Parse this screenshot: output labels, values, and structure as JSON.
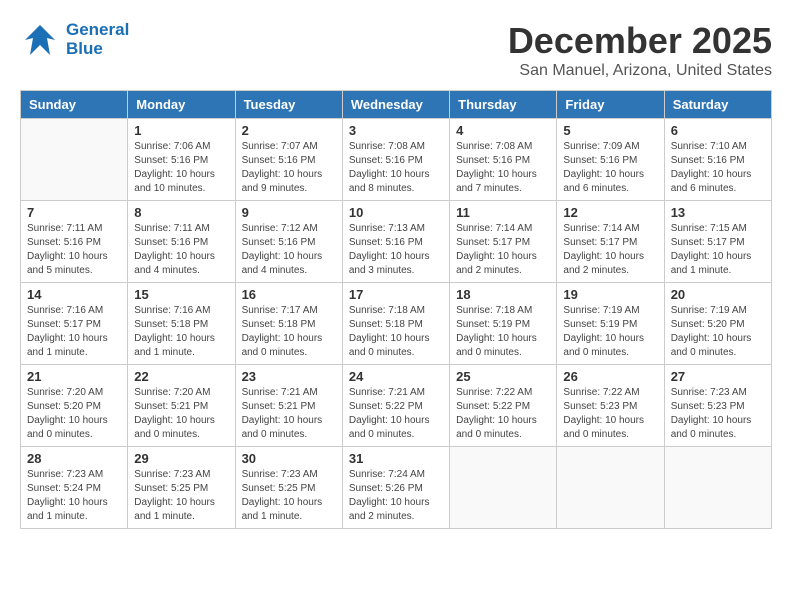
{
  "header": {
    "logo_general": "General",
    "logo_blue": "Blue",
    "month_title": "December 2025",
    "location": "San Manuel, Arizona, United States"
  },
  "weekdays": [
    "Sunday",
    "Monday",
    "Tuesday",
    "Wednesday",
    "Thursday",
    "Friday",
    "Saturday"
  ],
  "weeks": [
    [
      {
        "day": "",
        "sunrise": "",
        "sunset": "",
        "daylight": ""
      },
      {
        "day": "1",
        "sunrise": "Sunrise: 7:06 AM",
        "sunset": "Sunset: 5:16 PM",
        "daylight": "Daylight: 10 hours and 10 minutes."
      },
      {
        "day": "2",
        "sunrise": "Sunrise: 7:07 AM",
        "sunset": "Sunset: 5:16 PM",
        "daylight": "Daylight: 10 hours and 9 minutes."
      },
      {
        "day": "3",
        "sunrise": "Sunrise: 7:08 AM",
        "sunset": "Sunset: 5:16 PM",
        "daylight": "Daylight: 10 hours and 8 minutes."
      },
      {
        "day": "4",
        "sunrise": "Sunrise: 7:08 AM",
        "sunset": "Sunset: 5:16 PM",
        "daylight": "Daylight: 10 hours and 7 minutes."
      },
      {
        "day": "5",
        "sunrise": "Sunrise: 7:09 AM",
        "sunset": "Sunset: 5:16 PM",
        "daylight": "Daylight: 10 hours and 6 minutes."
      },
      {
        "day": "6",
        "sunrise": "Sunrise: 7:10 AM",
        "sunset": "Sunset: 5:16 PM",
        "daylight": "Daylight: 10 hours and 6 minutes."
      }
    ],
    [
      {
        "day": "7",
        "sunrise": "Sunrise: 7:11 AM",
        "sunset": "Sunset: 5:16 PM",
        "daylight": "Daylight: 10 hours and 5 minutes."
      },
      {
        "day": "8",
        "sunrise": "Sunrise: 7:11 AM",
        "sunset": "Sunset: 5:16 PM",
        "daylight": "Daylight: 10 hours and 4 minutes."
      },
      {
        "day": "9",
        "sunrise": "Sunrise: 7:12 AM",
        "sunset": "Sunset: 5:16 PM",
        "daylight": "Daylight: 10 hours and 4 minutes."
      },
      {
        "day": "10",
        "sunrise": "Sunrise: 7:13 AM",
        "sunset": "Sunset: 5:16 PM",
        "daylight": "Daylight: 10 hours and 3 minutes."
      },
      {
        "day": "11",
        "sunrise": "Sunrise: 7:14 AM",
        "sunset": "Sunset: 5:17 PM",
        "daylight": "Daylight: 10 hours and 2 minutes."
      },
      {
        "day": "12",
        "sunrise": "Sunrise: 7:14 AM",
        "sunset": "Sunset: 5:17 PM",
        "daylight": "Daylight: 10 hours and 2 minutes."
      },
      {
        "day": "13",
        "sunrise": "Sunrise: 7:15 AM",
        "sunset": "Sunset: 5:17 PM",
        "daylight": "Daylight: 10 hours and 1 minute."
      }
    ],
    [
      {
        "day": "14",
        "sunrise": "Sunrise: 7:16 AM",
        "sunset": "Sunset: 5:17 PM",
        "daylight": "Daylight: 10 hours and 1 minute."
      },
      {
        "day": "15",
        "sunrise": "Sunrise: 7:16 AM",
        "sunset": "Sunset: 5:18 PM",
        "daylight": "Daylight: 10 hours and 1 minute."
      },
      {
        "day": "16",
        "sunrise": "Sunrise: 7:17 AM",
        "sunset": "Sunset: 5:18 PM",
        "daylight": "Daylight: 10 hours and 0 minutes."
      },
      {
        "day": "17",
        "sunrise": "Sunrise: 7:18 AM",
        "sunset": "Sunset: 5:18 PM",
        "daylight": "Daylight: 10 hours and 0 minutes."
      },
      {
        "day": "18",
        "sunrise": "Sunrise: 7:18 AM",
        "sunset": "Sunset: 5:19 PM",
        "daylight": "Daylight: 10 hours and 0 minutes."
      },
      {
        "day": "19",
        "sunrise": "Sunrise: 7:19 AM",
        "sunset": "Sunset: 5:19 PM",
        "daylight": "Daylight: 10 hours and 0 minutes."
      },
      {
        "day": "20",
        "sunrise": "Sunrise: 7:19 AM",
        "sunset": "Sunset: 5:20 PM",
        "daylight": "Daylight: 10 hours and 0 minutes."
      }
    ],
    [
      {
        "day": "21",
        "sunrise": "Sunrise: 7:20 AM",
        "sunset": "Sunset: 5:20 PM",
        "daylight": "Daylight: 10 hours and 0 minutes."
      },
      {
        "day": "22",
        "sunrise": "Sunrise: 7:20 AM",
        "sunset": "Sunset: 5:21 PM",
        "daylight": "Daylight: 10 hours and 0 minutes."
      },
      {
        "day": "23",
        "sunrise": "Sunrise: 7:21 AM",
        "sunset": "Sunset: 5:21 PM",
        "daylight": "Daylight: 10 hours and 0 minutes."
      },
      {
        "day": "24",
        "sunrise": "Sunrise: 7:21 AM",
        "sunset": "Sunset: 5:22 PM",
        "daylight": "Daylight: 10 hours and 0 minutes."
      },
      {
        "day": "25",
        "sunrise": "Sunrise: 7:22 AM",
        "sunset": "Sunset: 5:22 PM",
        "daylight": "Daylight: 10 hours and 0 minutes."
      },
      {
        "day": "26",
        "sunrise": "Sunrise: 7:22 AM",
        "sunset": "Sunset: 5:23 PM",
        "daylight": "Daylight: 10 hours and 0 minutes."
      },
      {
        "day": "27",
        "sunrise": "Sunrise: 7:23 AM",
        "sunset": "Sunset: 5:23 PM",
        "daylight": "Daylight: 10 hours and 0 minutes."
      }
    ],
    [
      {
        "day": "28",
        "sunrise": "Sunrise: 7:23 AM",
        "sunset": "Sunset: 5:24 PM",
        "daylight": "Daylight: 10 hours and 1 minute."
      },
      {
        "day": "29",
        "sunrise": "Sunrise: 7:23 AM",
        "sunset": "Sunset: 5:25 PM",
        "daylight": "Daylight: 10 hours and 1 minute."
      },
      {
        "day": "30",
        "sunrise": "Sunrise: 7:23 AM",
        "sunset": "Sunset: 5:25 PM",
        "daylight": "Daylight: 10 hours and 1 minute."
      },
      {
        "day": "31",
        "sunrise": "Sunrise: 7:24 AM",
        "sunset": "Sunset: 5:26 PM",
        "daylight": "Daylight: 10 hours and 2 minutes."
      },
      {
        "day": "",
        "sunrise": "",
        "sunset": "",
        "daylight": ""
      },
      {
        "day": "",
        "sunrise": "",
        "sunset": "",
        "daylight": ""
      },
      {
        "day": "",
        "sunrise": "",
        "sunset": "",
        "daylight": ""
      }
    ]
  ]
}
